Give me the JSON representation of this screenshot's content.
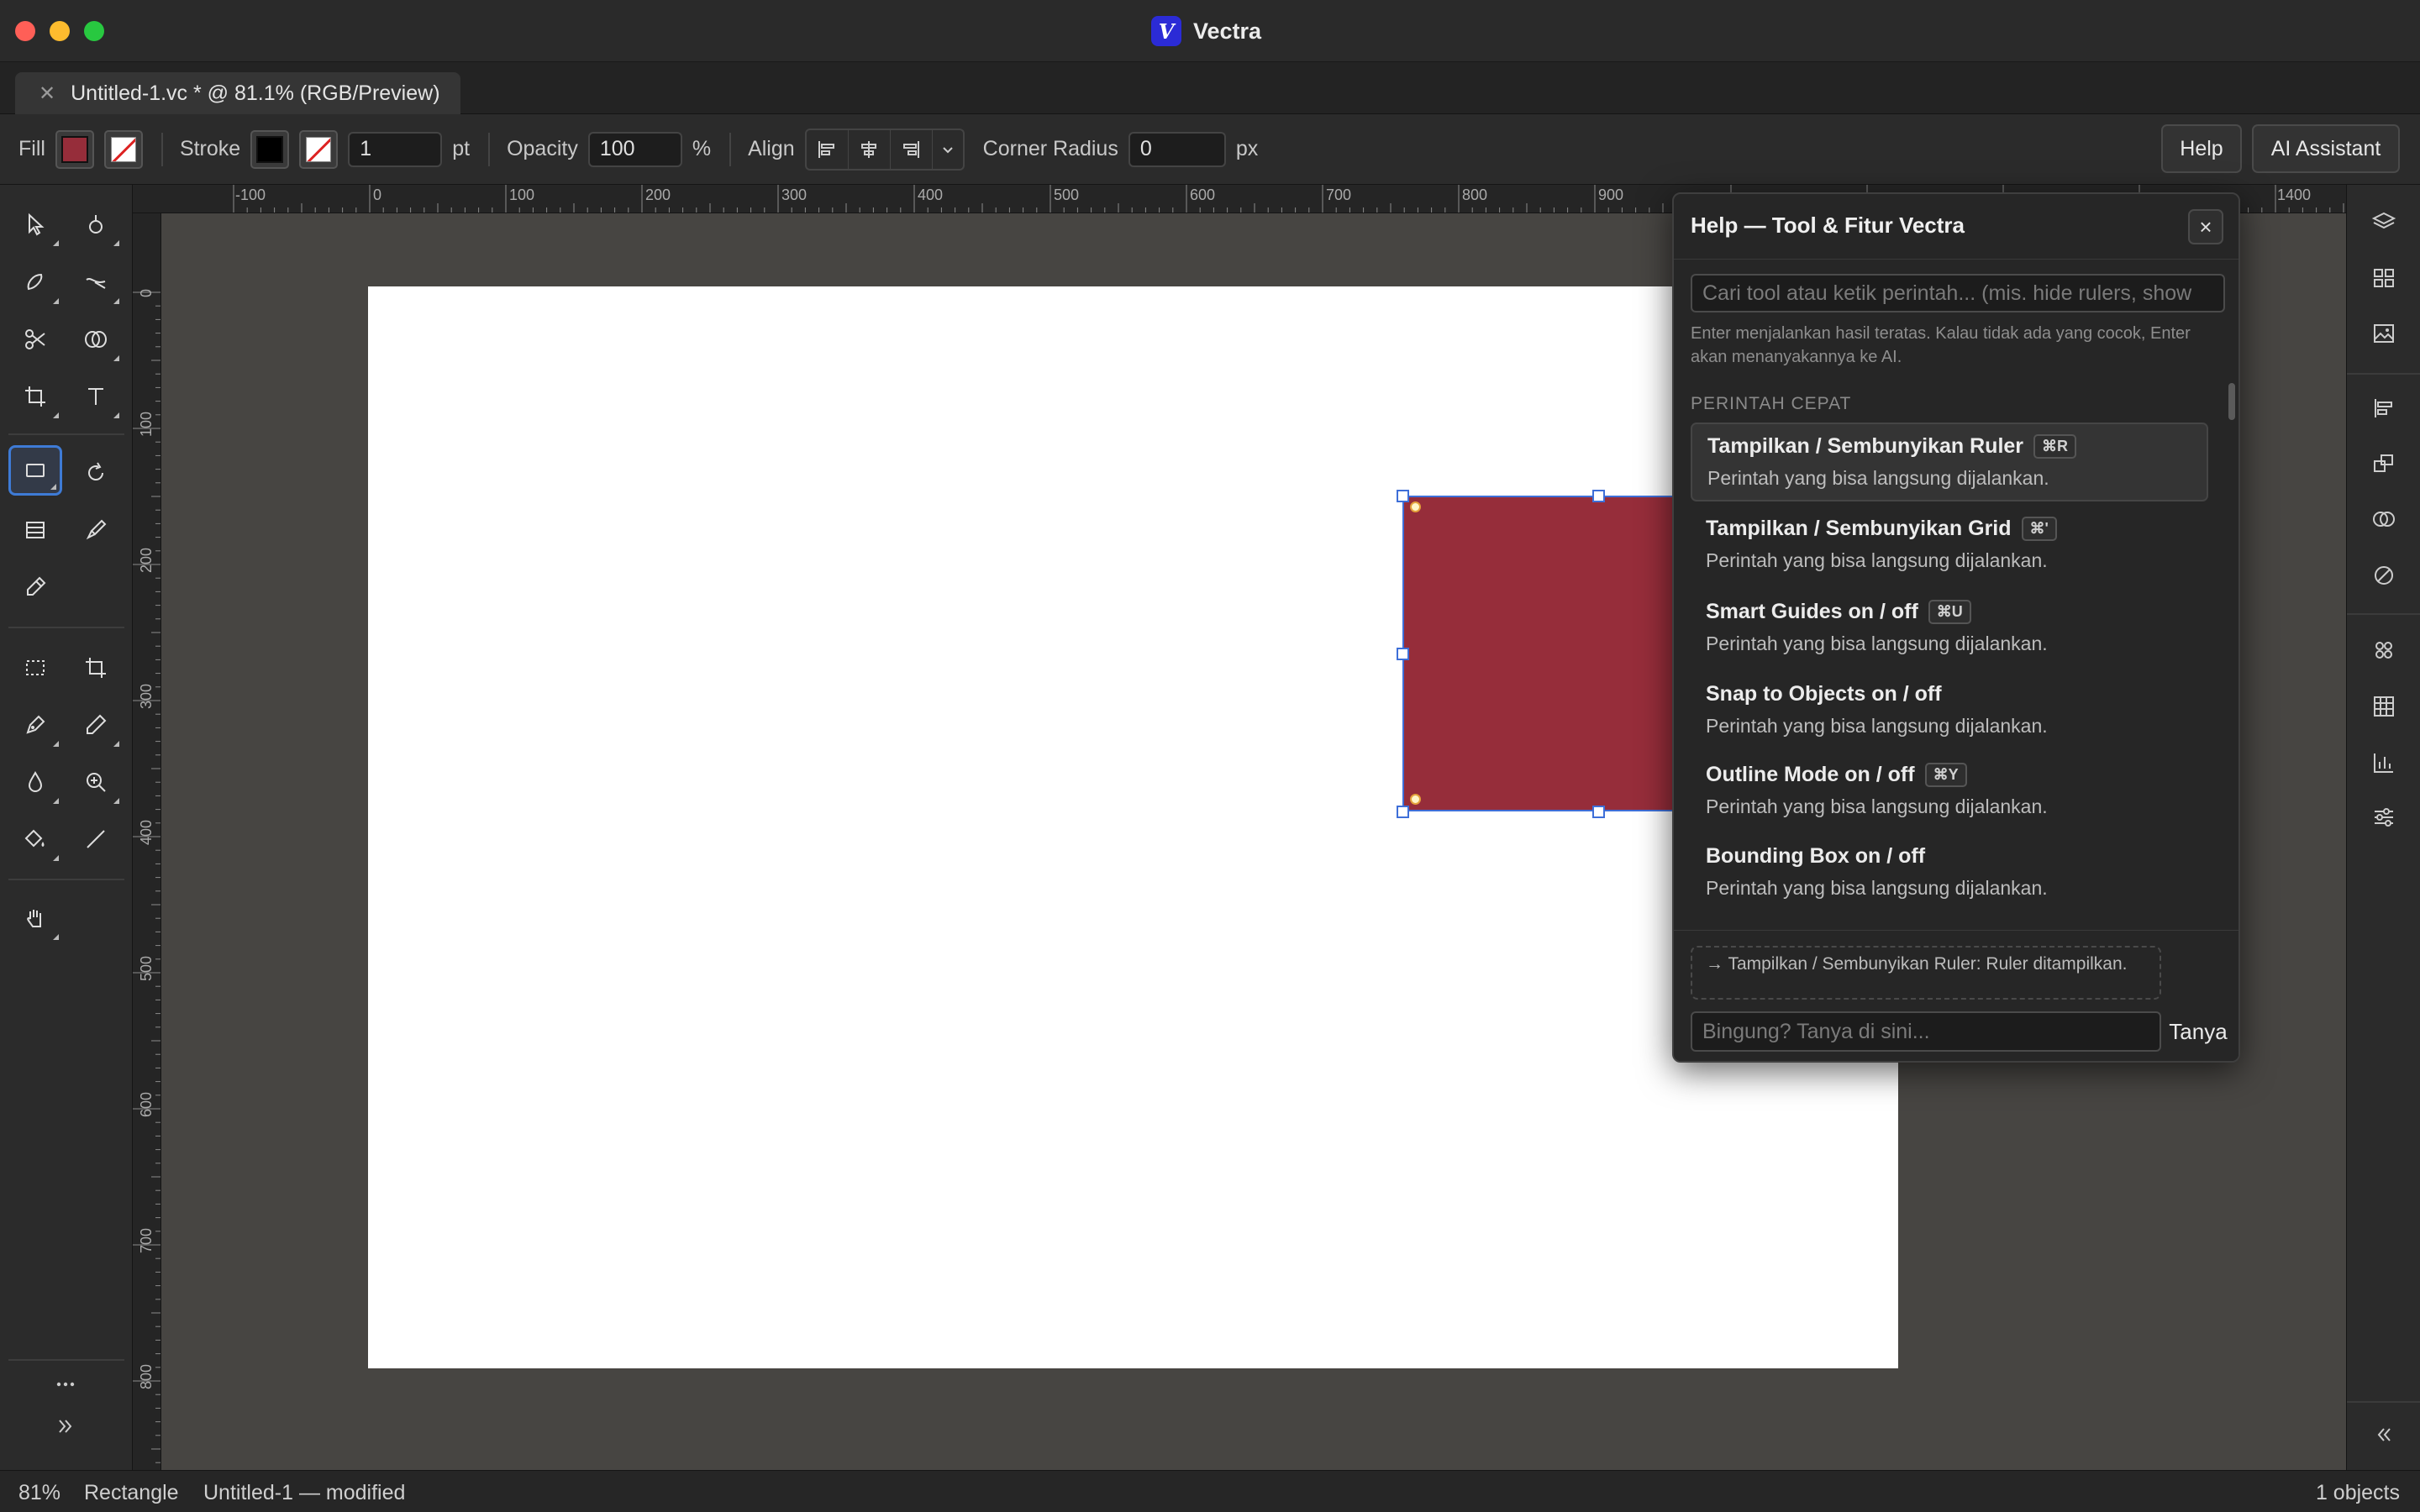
{
  "app": {
    "name": "Vectra",
    "logo_letter": "V"
  },
  "tab": {
    "label": "Untitled-1.vc * @ 81.1% (RGB/Preview)"
  },
  "options": {
    "fill_label": "Fill",
    "fill_color": "#962d3a",
    "stroke_label": "Stroke",
    "stroke_color": "#000000",
    "stroke_width": "1",
    "stroke_unit": "pt",
    "opacity_label": "Opacity",
    "opacity_value": "100",
    "opacity_unit": "%",
    "align_label": "Align",
    "corner_radius_label": "Corner Radius",
    "corner_radius_value": "0",
    "corner_radius_unit": "px",
    "help_button": "Help",
    "ai_button": "AI Assistant"
  },
  "tools": [
    "selection-tool",
    "direct-selection-tool",
    "blob-brush-tool",
    "curvature-tool",
    "scissors-tool",
    "shape-builder-tool",
    "artboard-tool",
    "type-tool",
    "rectangle-tool",
    "rotate-tool",
    "table-tool",
    "paint-brush-tool",
    "eyedropper-tool",
    "marquee-tool",
    "crop-tool",
    "pen-tool",
    "pencil-tool",
    "blur-tool",
    "zoom-tool",
    "fill-tool",
    "line-tool",
    "hand-tool"
  ],
  "active_tool": "rectangle-tool",
  "rulers": {
    "h_labels": [
      "-100",
      "0",
      "100",
      "200",
      "300",
      "400",
      "500",
      "600",
      "700",
      "800",
      "900",
      "1400"
    ],
    "v_labels": [
      "0",
      "100",
      "200",
      "300",
      "400",
      "500",
      "600",
      "700",
      "800"
    ]
  },
  "canvas": {
    "shape": "Rectangle",
    "shape_color": "#962d3a",
    "selection_color": "#3e6fd8"
  },
  "help_panel": {
    "title": "Help — Tool & Fitur Vectra",
    "close_label": "×",
    "search_placeholder": "Cari tool atau ketik perintah... (mis. hide rulers, show",
    "hint": "Enter menjalankan hasil teratas. Kalau tidak ada yang cocok, Enter akan menanyakannya ke AI.",
    "section_label": "PERINTAH CEPAT",
    "commands": [
      {
        "title": "Tampilkan / Sembunyikan Ruler",
        "shortcut": "⌘R",
        "desc": "Perintah yang bisa langsung dijalankan."
      },
      {
        "title": "Tampilkan / Sembunyikan Grid",
        "shortcut": "⌘'",
        "desc": "Perintah yang bisa langsung dijalankan."
      },
      {
        "title": "Smart Guides on / off",
        "shortcut": "⌘U",
        "desc": "Perintah yang bisa langsung dijalankan."
      },
      {
        "title": "Snap to Objects on / off",
        "shortcut": "",
        "desc": "Perintah yang bisa langsung dijalankan."
      },
      {
        "title": "Outline Mode on / off",
        "shortcut": "⌘Y",
        "desc": "Perintah yang bisa langsung dijalankan."
      },
      {
        "title": "Bounding Box on / off",
        "shortcut": "",
        "desc": "Perintah yang bisa langsung dijalankan."
      }
    ],
    "log": "→ Tampilkan / Sembunyikan Ruler: Ruler ditampilkan.",
    "ask_placeholder": "Bingung? Tanya di sini...",
    "ask_button": "Tanya"
  },
  "status": {
    "zoom": "81%",
    "tool_name": "Rectangle",
    "document": "Untitled-1 — modified",
    "objects": "1 objects"
  }
}
